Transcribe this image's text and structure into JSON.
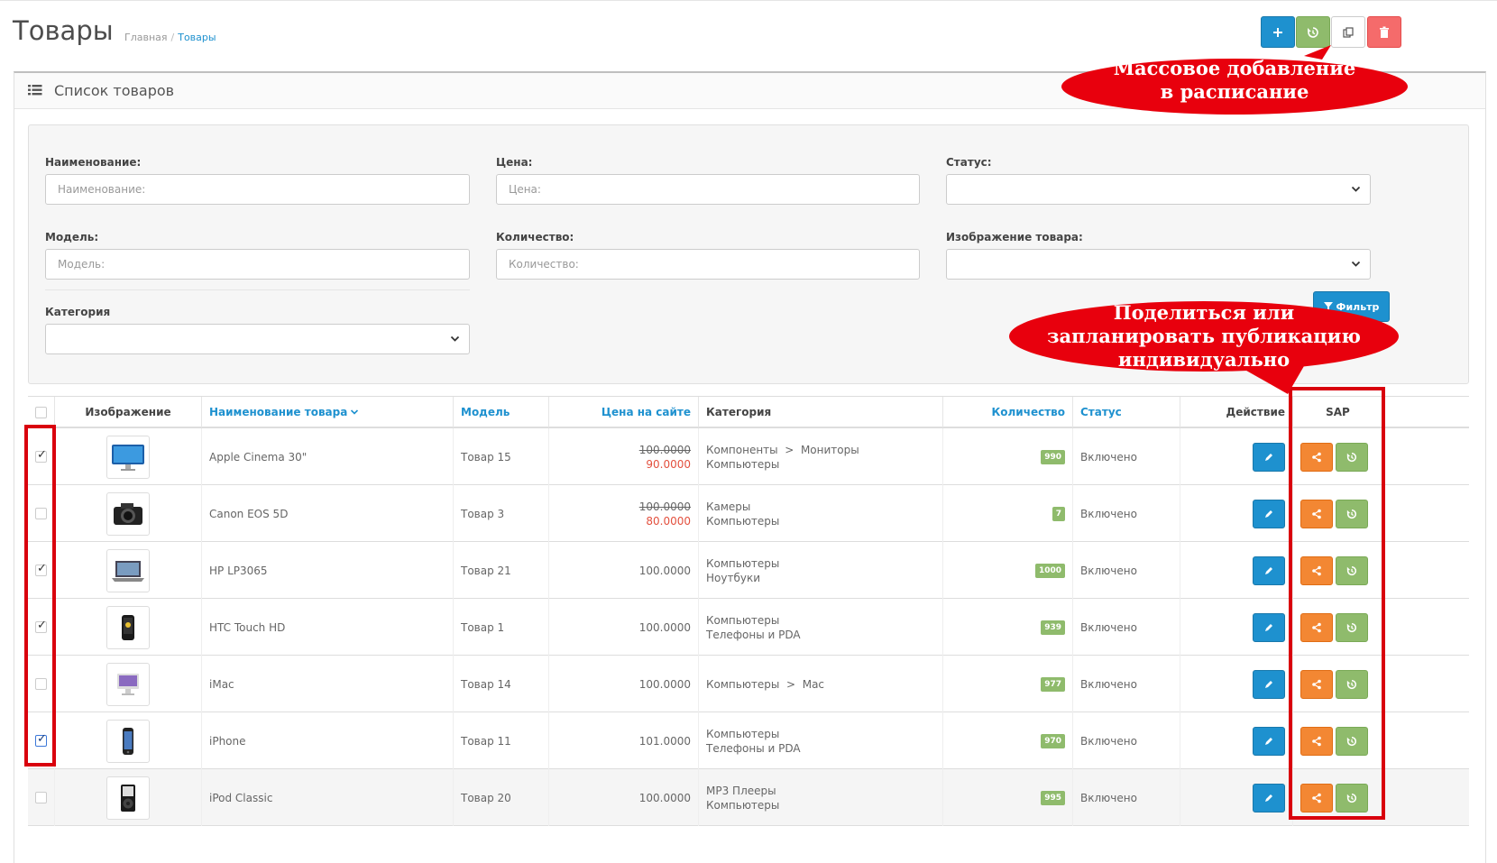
{
  "header": {
    "title": "Товары",
    "breadcrumb": [
      "Главная",
      "Товары"
    ]
  },
  "colors": {
    "primary": "#1e91cf",
    "success": "#8fbb6c",
    "warning": "#f38733",
    "danger": "#f56b6b",
    "highlight": "#d9000d"
  },
  "header_buttons": [
    {
      "icon": "plus-icon"
    },
    {
      "icon": "history-icon"
    },
    {
      "icon": "copy-icon"
    },
    {
      "icon": "trash-icon"
    }
  ],
  "panel": {
    "title": "Список товаров"
  },
  "filter": {
    "name_label": "Наименование:",
    "name_placeholder": "Наименование:",
    "price_label": "Цена:",
    "price_placeholder": "Цена:",
    "status_label": "Статус:",
    "model_label": "Модель:",
    "model_placeholder": "Модель:",
    "quantity_label": "Количество:",
    "quantity_placeholder": "Количество:",
    "image_label": "Изображение товара:",
    "category_label": "Категория",
    "button_label": "Фильтр"
  },
  "table": {
    "headers": {
      "image": "Изображение",
      "name": "Наименование товара",
      "model": "Модель",
      "price": "Цена на сайте",
      "category": "Категория",
      "quantity": "Количество",
      "status": "Статус",
      "action": "Действие",
      "sap": "SAP"
    },
    "rows": [
      {
        "checked": true,
        "name": "Apple Cinema 30\"",
        "model": "Товар 15",
        "price": "100.0000",
        "special": "90.0000",
        "cat1": "Компоненты  >  Мониторы",
        "cat2": "Компьютеры",
        "qty": "990",
        "status": "Включено"
      },
      {
        "checked": false,
        "name": "Canon EOS 5D",
        "model": "Товар 3",
        "price": "100.0000",
        "special": "80.0000",
        "cat1": "Камеры",
        "cat2": "Компьютеры",
        "qty": "7",
        "status": "Включено"
      },
      {
        "checked": true,
        "name": "HP LP3065",
        "model": "Товар 21",
        "price": "100.0000",
        "special": "",
        "cat1": "Компьютеры",
        "cat2": "Ноутбуки",
        "qty": "1000",
        "status": "Включено"
      },
      {
        "checked": true,
        "name": "HTC Touch HD",
        "model": "Товар 1",
        "price": "100.0000",
        "special": "",
        "cat1": "Компьютеры",
        "cat2": "Телефоны и PDA",
        "qty": "939",
        "status": "Включено"
      },
      {
        "checked": false,
        "name": "iMac",
        "model": "Товар 14",
        "price": "100.0000",
        "special": "",
        "cat1": "Компьютеры  >  Mac",
        "cat2": "",
        "qty": "977",
        "status": "Включено"
      },
      {
        "checked": true,
        "name": "iPhone",
        "model": "Товар 11",
        "price": "101.0000",
        "special": "",
        "cat1": "Компьютеры",
        "cat2": "Телефоны и PDA",
        "qty": "970",
        "status": "Включено"
      },
      {
        "checked": false,
        "name": "iPod Classic",
        "model": "Товар 20",
        "price": "100.0000",
        "special": "",
        "cat1": "MP3 Плееры",
        "cat2": "Компьютеры",
        "qty": "995",
        "status": "Включено"
      }
    ]
  },
  "callouts": {
    "mass": "Массовое добавление в расписание",
    "individual": "Поделиться или запланировать публикацию индивидуально"
  }
}
